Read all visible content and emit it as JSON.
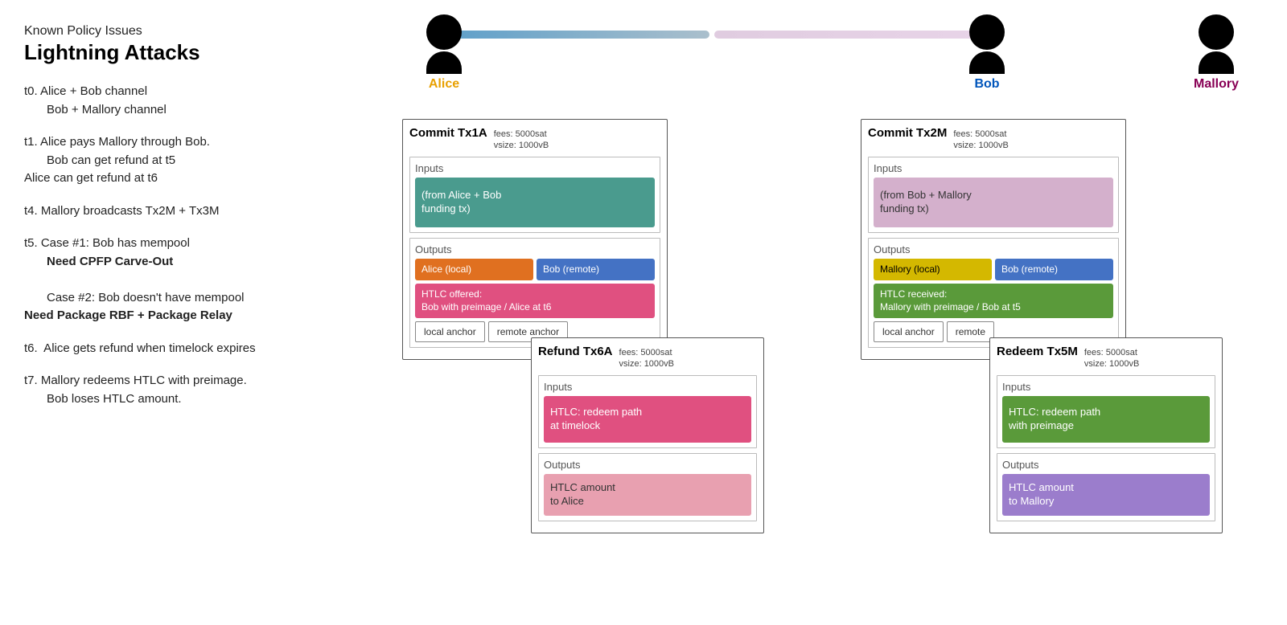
{
  "left": {
    "subtitle": "Known Policy Issues",
    "title": "Lightning Attacks",
    "items": [
      {
        "id": "t0",
        "text": "t0. Alice + Bob channel\n     Bob + Mallory channel"
      },
      {
        "id": "t1",
        "text": "t1. Alice pays Mallory through Bob.\n     Bob can get refund at t5\n     Alice can get refund at t6"
      },
      {
        "id": "t4",
        "text": "t4. Mallory broadcasts Tx2M + Tx3M"
      },
      {
        "id": "t5",
        "label": "t5. Case #1: Bob has mempool",
        "bold": "Need CPFP Carve-Out",
        "extra": "Case #2: Bob doesn't have mempool",
        "bold2": "Need Package RBF + Package Relay"
      },
      {
        "id": "t6",
        "text": "t6.  Alice gets refund when timelock expires"
      },
      {
        "id": "t7",
        "text": "t7. Mallory redeems HTLC with preimage.\n     Bob loses HTLC amount."
      }
    ]
  },
  "network": {
    "actors": [
      {
        "name": "Alice",
        "color": "alice"
      },
      {
        "name": "Bob",
        "color": "bob"
      },
      {
        "name": "Mallory",
        "color": "mallory"
      }
    ]
  },
  "tx1a": {
    "title": "Commit Tx1A",
    "fees": "fees: 5000sat",
    "vsize": "vsize: 1000vB",
    "inputs_label": "Inputs",
    "input1": "(from Alice + Bob\nfunding tx)",
    "outputs_label": "Outputs",
    "out1": "Alice (local)",
    "out2": "Bob (remote)",
    "htlc_label": "HTLC offered:\nBob with preimage / Alice at t6",
    "anchor1": "local anchor",
    "anchor2": "remote anchor"
  },
  "tx2m": {
    "title": "Commit Tx2M",
    "fees": "fees: 5000sat",
    "vsize": "vsize: 1000vB",
    "inputs_label": "Inputs",
    "input1": "(from Bob + Mallory\nfunding tx)",
    "outputs_label": "Outputs",
    "out1": "Mallory (local)",
    "out2": "Bob (remote)",
    "htlc_label": "HTLC received:\nMallory with preimage / Bob at t5",
    "anchor1": "local anchor",
    "anchor2": "remote"
  },
  "tx6a": {
    "title": "Refund Tx6A",
    "fees": "fees: 5000sat",
    "vsize": "vsize: 1000vB",
    "inputs_label": "Inputs",
    "input1": "HTLC: redeem path\nat timelock",
    "outputs_label": "Outputs",
    "out1": "HTLC amount\nto Alice"
  },
  "tx5m": {
    "title": "Redeem Tx5M",
    "fees": "fees: 5000sat",
    "vsize": "vsize: 1000vB",
    "inputs_label": "Inputs",
    "input1": "HTLC: redeem path\nwith preimage",
    "outputs_label": "Outputs",
    "out1": "HTLC amount\nto Mallory"
  }
}
